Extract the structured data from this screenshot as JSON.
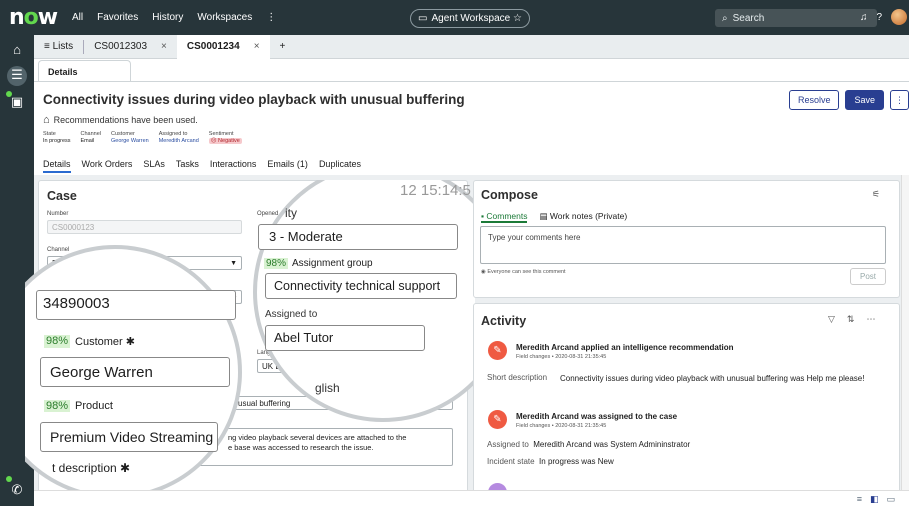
{
  "topbar": {
    "logo": "now",
    "nav": [
      "All",
      "Favorites",
      "History",
      "Workspaces",
      "⋮"
    ],
    "workspace_label": "Agent Workspace ☆",
    "search_placeholder": "Search"
  },
  "tabs": {
    "lists_label": "≡ Lists",
    "items": [
      {
        "label": "CS0012303",
        "close": "×"
      },
      {
        "label": "CS0001234",
        "close": "×"
      }
    ],
    "add": "+"
  },
  "subtab": "Details",
  "record": {
    "title": "Connectivity issues during video playback with unusual buffering",
    "recommendation_text": "Recommendations have been used.",
    "actions": [
      "Resolve",
      "Save",
      "⋮"
    ],
    "meta": [
      {
        "label": "State",
        "value": "In progress"
      },
      {
        "label": "Channel",
        "value": "Email"
      },
      {
        "label": "Customer",
        "value": "George Warren"
      },
      {
        "label": "Assigned to",
        "value": "Meredith Arcand"
      },
      {
        "label": "Sentiment",
        "value": "☹ Negative"
      }
    ],
    "nav_tabs": [
      "Details",
      "Work Orders",
      "SLAs",
      "Tasks",
      "Interactions",
      "Emails (1)",
      "Duplicates"
    ]
  },
  "case": {
    "heading": "Case",
    "number_label": "Number",
    "number_value": "CS0000123",
    "opened_label": "Opened",
    "channel_label": "Channel",
    "channel_value": "Email",
    "account_label": "Account number",
    "account_value": "3489",
    "language_label": "Lang",
    "language_value": "UK En",
    "short_desc_value": "usual buffering",
    "desc_value": "ng video playback several devices are attached to the",
    "desc_value2": "e base was accessed to research the issue."
  },
  "magnifier": {
    "priority_label": "ity",
    "priority_value": "3 - Moderate",
    "assign_group_pct": "98%",
    "assign_group_label": "Assignment group",
    "assign_group_value": "Connectivity technical support",
    "assigned_to_label": "Assigned to",
    "assigned_to_value": "Abel Tutor",
    "account_big": "34890003",
    "customer_pct": "98%",
    "customer_label": "Customer ✱",
    "customer_value": "George Warren",
    "product_pct": "98%",
    "product_label": "Product",
    "product_value": "Premium Video Streaming",
    "short_desc_label": "t description ✱",
    "english": "glish",
    "top_number": "12 15:14:5"
  },
  "compose": {
    "heading": "Compose",
    "tab_comments": "Comments",
    "tab_worknotes": "Work notes (Private)",
    "placeholder": "Type your comments here",
    "visibility": "Everyone can see this comment",
    "post": "Post"
  },
  "activity": {
    "heading": "Activity",
    "entries": [
      {
        "title": "Meredith Arcand applied an intelligence recommendation",
        "sub": "Field changes • 2020-08-31 21:35:45",
        "field": "Short description",
        "value": "Connectivity issues during video playback with unusual buffering was Help me please!"
      },
      {
        "title": "Meredith Arcand was assigned to the case",
        "sub": "Field changes • 2020-08-31 21:35:45",
        "field1": "Assigned to",
        "value1": "Meredith Arcand was System Admininstrator",
        "field2": "Incident state",
        "value2": "In progress was New"
      }
    ]
  },
  "colors": {
    "topbar": "#27353a",
    "accent": "#293e91",
    "green": "#62d84e",
    "negative": "#b0262d",
    "activity_badge": "#ef5a42"
  }
}
